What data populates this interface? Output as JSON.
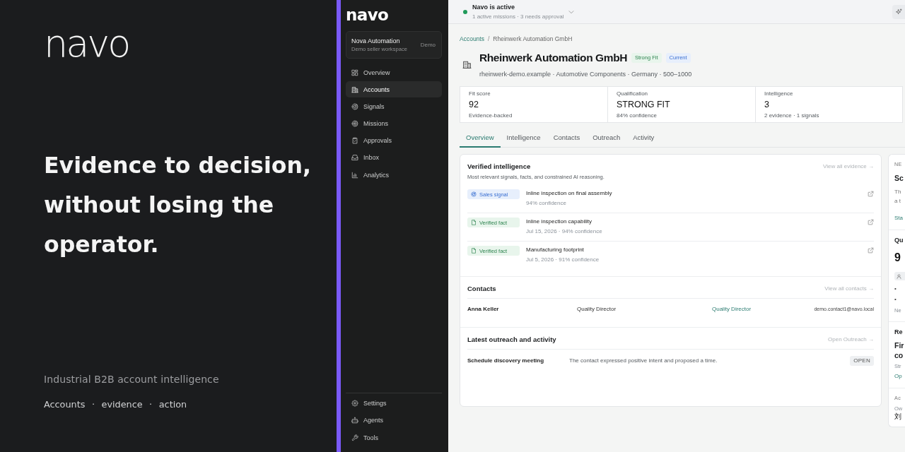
{
  "hero": {
    "logo": "navo",
    "headline": "Evidence to decision, without losing the operator.",
    "tagline": "Industrial B2B account intelligence",
    "pillars": "Accounts · evidence · action"
  },
  "sidebar": {
    "logo": "navo",
    "workspace": {
      "name": "Nova Automation",
      "subtitle": "Demo seller workspace",
      "tag": "Demo"
    },
    "nav": [
      {
        "label": "Overview",
        "selected": false
      },
      {
        "label": "Accounts",
        "selected": true
      },
      {
        "label": "Signals",
        "selected": false
      },
      {
        "label": "Missions",
        "selected": false
      },
      {
        "label": "Approvals",
        "selected": false
      },
      {
        "label": "Inbox",
        "selected": false
      },
      {
        "label": "Analytics",
        "selected": false
      }
    ],
    "footer_nav": [
      {
        "label": "Settings",
        "selected": false
      },
      {
        "label": "Agents",
        "selected": false
      },
      {
        "label": "Tools",
        "selected": false
      }
    ]
  },
  "top_bar": {
    "status": {
      "title": "Navo is active",
      "detail": "1 active missions · 3 needs approval",
      "active": true
    }
  },
  "breadcrumb": {
    "items": [
      {
        "label": "Accounts",
        "link": true
      },
      {
        "label": "Rheinwerk Automation GmbH",
        "link": false
      }
    ],
    "separator": "/"
  },
  "account": {
    "name": "Rheinwerk Automation GmbH",
    "badges": [
      {
        "kind": "fit",
        "label": "Strong Fit"
      },
      {
        "kind": "status",
        "label": "Current"
      }
    ],
    "meta": "rheinwerk-demo.example · Automotive Components · Germany · 500–1000"
  },
  "stats": [
    {
      "label": "Fit score",
      "value": "92",
      "note": "Evidence-backed"
    },
    {
      "label": "Qualification",
      "value": "STRONG FIT",
      "note": "84% confidence"
    },
    {
      "label": "Intelligence",
      "value": "3",
      "note": "2 evidence · 1 signals"
    }
  ],
  "tabs": [
    {
      "label": "Overview",
      "selected": true
    },
    {
      "label": "Intelligence",
      "selected": false
    },
    {
      "label": "Contacts",
      "selected": false
    },
    {
      "label": "Outreach",
      "selected": false
    },
    {
      "label": "Activity",
      "selected": false
    }
  ],
  "intelligence": {
    "title": "Verified intelligence",
    "link": "View all evidence →",
    "subtitle": "Most relevant signals, facts, and constrained AI reasoning.",
    "items": [
      {
        "kind": "signal",
        "tag": "Sales signal",
        "title": "Inline inspection on final assembly",
        "meta": "94% confidence"
      },
      {
        "kind": "fact",
        "tag": "Verified fact",
        "title": "Inline inspection capability",
        "meta": "Jul 15, 2026 · 94% confidence"
      },
      {
        "kind": "fact",
        "tag": "Verified fact",
        "title": "Manufacturing footprint",
        "meta": "Jul 5, 2026 · 91% confidence"
      }
    ]
  },
  "contacts": {
    "title": "Contacts",
    "link": "View all contacts →",
    "rows": [
      {
        "name": "Anna Keller",
        "title": "Quality Director",
        "column_3": "Quality Director",
        "email": "demo.contact1@navo.local"
      }
    ]
  },
  "outreach": {
    "title": "Latest outreach and activity",
    "link": "Open Outreach →",
    "rows": [
      {
        "title": "Schedule discovery meeting",
        "summary": "The contact expressed positive intent and proposed a time.",
        "status": "OPEN"
      }
    ]
  },
  "side_panel": {
    "sections": [
      {
        "eyebrow": "NE",
        "heading": [
          "Sc"
        ],
        "lines": [
          "Th",
          "a t"
        ],
        "link": "Sta"
      },
      {
        "title": "Qu",
        "value": "9",
        "chip": true,
        "bullets": [
          "•",
          "•"
        ],
        "note": "Ne"
      },
      {
        "title": "Re",
        "heading": [
          "Fir",
          "co"
        ],
        "note": "Str",
        "link": "Op"
      },
      {
        "eyebrow": "Ac",
        "note": "Ow",
        "text": "刘"
      }
    ]
  }
}
